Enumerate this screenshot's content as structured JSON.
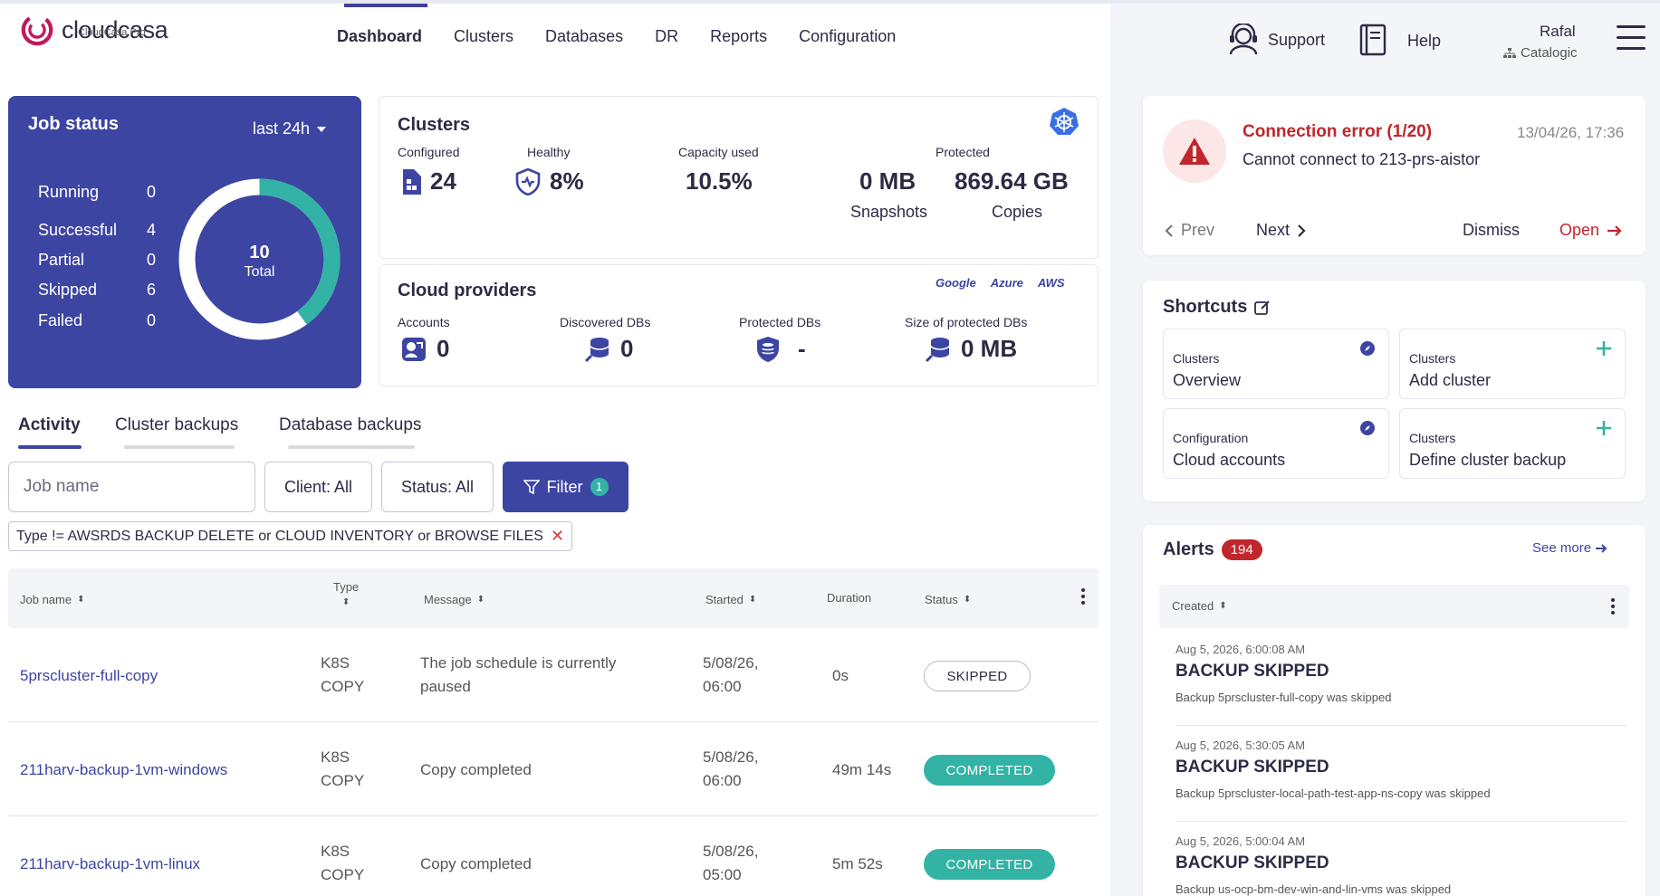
{
  "brand": {
    "name": "cloudcasa",
    "subtitle": "CloudCasa Pro"
  },
  "nav": [
    "Dashboard",
    "Clusters",
    "Databases",
    "DR",
    "Reports",
    "Configuration"
  ],
  "header": {
    "support": "Support",
    "help": "Help",
    "user_name": "Rafal",
    "user_org": "Catalogic"
  },
  "job_status": {
    "title": "Job status",
    "range": "last 24h",
    "rows": [
      {
        "label": "Running",
        "value": "0"
      },
      {
        "label": "Successful",
        "value": "4"
      },
      {
        "label": "Partial",
        "value": "0"
      },
      {
        "label": "Skipped",
        "value": "6"
      },
      {
        "label": "Failed",
        "value": "0"
      }
    ],
    "total": "10",
    "total_label": "Total",
    "successful_fraction": 0.4
  },
  "clusters": {
    "title": "Clusters",
    "configured_label": "Configured",
    "configured": "24",
    "healthy_label": "Healthy",
    "healthy": "8%",
    "capacity_label": "Capacity used",
    "capacity": "10.5%",
    "protected_label": "Protected",
    "snapshots": "0 MB",
    "snapshots_label": "Snapshots",
    "copies": "869.64 GB",
    "copies_label": "Copies"
  },
  "cloud": {
    "title": "Cloud providers",
    "providers": [
      "Google",
      "Azure",
      "AWS"
    ],
    "accounts_label": "Accounts",
    "accounts": "0",
    "discovered_label": "Discovered DBs",
    "discovered": "0",
    "protected_label": "Protected DBs",
    "protected": "-",
    "size_label": "Size of protected DBs",
    "size": "0 MB"
  },
  "tabs": [
    "Activity",
    "Cluster backups",
    "Database backups"
  ],
  "filters": {
    "job_placeholder": "Job name",
    "client": "Client: All",
    "status": "Status: All",
    "filter": "Filter",
    "filter_count": "1",
    "chip": "Type != AWSRDS BACKUP DELETE or CLOUD INVENTORY or BROWSE FILES"
  },
  "table": {
    "headers": {
      "job": "Job name",
      "type": "Type",
      "message": "Message",
      "started": "Started",
      "duration": "Duration",
      "status": "Status"
    },
    "rows": [
      {
        "job": "5prscluster-full-copy",
        "type1": "K8S",
        "type2": "COPY",
        "msg1": "The job schedule is currently",
        "msg2": "paused",
        "start1": "5/08/26,",
        "start2": "06:00",
        "duration": "0s",
        "status": "SKIPPED"
      },
      {
        "job": "211harv-backup-1vm-windows",
        "type1": "K8S",
        "type2": "COPY",
        "msg1": "Copy completed",
        "msg2": "",
        "start1": "5/08/26,",
        "start2": "06:00",
        "duration": "49m 14s",
        "status": "COMPLETED"
      },
      {
        "job": "211harv-backup-1vm-linux",
        "type1": "K8S",
        "type2": "COPY",
        "msg1": "Copy completed",
        "msg2": "",
        "start1": "5/08/26,",
        "start2": "05:00",
        "duration": "5m 52s",
        "status": "COMPLETED"
      }
    ]
  },
  "notification": {
    "title": "Connection error (1/20)",
    "time": "13/04/26, 17:36",
    "message": "Cannot connect to 213-prs-aistor",
    "prev": "Prev",
    "next": "Next",
    "dismiss": "Dismiss",
    "open": "Open"
  },
  "shortcuts": {
    "title": "Shortcuts",
    "items": [
      {
        "category": "Clusters",
        "name": "Overview",
        "icon": "compass-icon"
      },
      {
        "category": "Clusters",
        "name": "Add cluster",
        "icon": "plus-icon"
      },
      {
        "category": "Configuration",
        "name": "Cloud accounts",
        "icon": "compass-icon"
      },
      {
        "category": "Clusters",
        "name": "Define cluster backup",
        "icon": "plus-icon"
      }
    ]
  },
  "alerts": {
    "title": "Alerts",
    "count": "194",
    "see_more": "See more",
    "created_label": "Created",
    "items": [
      {
        "time": "Aug 5, 2026, 6:00:08 AM",
        "title": "BACKUP SKIPPED",
        "msg": "Backup 5prscluster-full-copy was skipped"
      },
      {
        "time": "Aug 5, 2026, 5:30:05 AM",
        "title": "BACKUP SKIPPED",
        "msg": "Backup 5prscluster-local-path-test-app-ns-copy was skipped"
      },
      {
        "time": "Aug 5, 2026, 5:00:04 AM",
        "title": "BACKUP SKIPPED",
        "msg": "Backup us-ocp-bm-dev-win-and-lin-vms was skipped"
      }
    ]
  },
  "colors": {
    "primary": "#3d45a3",
    "accent": "#32b3a5",
    "error": "#c0262c"
  }
}
